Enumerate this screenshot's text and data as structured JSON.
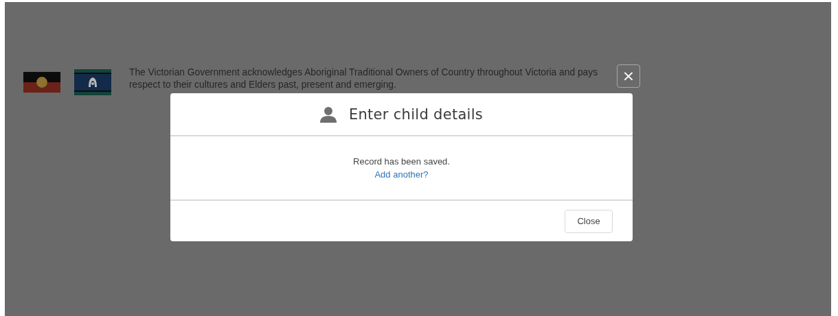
{
  "acknowledgement": {
    "text": "The Victorian Government acknowledges Aboriginal Traditional Owners of Country throughout Victoria and pays respect to their cultures and Elders past, present and emerging."
  },
  "dialog": {
    "title": "Enter child details",
    "message": "Record has been saved.",
    "link": "Add another?",
    "buttons": [
      "Close"
    ],
    "close_symbol": "×"
  }
}
